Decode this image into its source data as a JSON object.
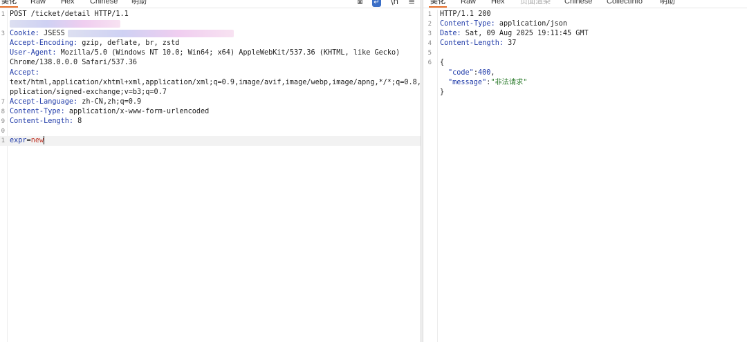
{
  "request": {
    "tabs": [
      "美化",
      "Raw",
      "Hex",
      "Chinese",
      "明助"
    ],
    "lines": [
      {
        "ln": "1",
        "text": "POST /ticket/detail HTTP/1.1"
      },
      {
        "ln": "",
        "redacted": true
      },
      {
        "ln": "3",
        "name": "Cookie:",
        "value": " JSESS"
      },
      {
        "ln": "",
        "name": "Accept-Encoding:",
        "value": " gzip, deflate, br, zstd"
      },
      {
        "ln": "",
        "name": "User-Agent:",
        "value": " Mozilla/5.0 (Windows NT 10.0; Win64; x64) AppleWebKit/537.36 (KHTML, like Gecko)"
      },
      {
        "ln": "",
        "text": "Chrome/138.0.0.0 Safari/537.36"
      },
      {
        "ln": "",
        "name": "Accept:",
        "value": ""
      },
      {
        "ln": "",
        "text": "text/html,application/xhtml+xml,application/xml;q=0.9,image/avif,image/webp,image/apng,*/*;q=0.8,a"
      },
      {
        "ln": "",
        "text": "pplication/signed-exchange;v=b3;q=0.7"
      },
      {
        "ln": "7",
        "name": "Accept-Language:",
        "value": " zh-CN,zh;q=0.9"
      },
      {
        "ln": "8",
        "name": "Content-Type:",
        "value": " application/x-www-form-urlencoded"
      },
      {
        "ln": "9",
        "name": "Content-Length:",
        "value": " 8"
      },
      {
        "ln": "0",
        "text": ""
      },
      {
        "ln": "1",
        "body_key": "expr",
        "body_eq": "=",
        "body_val": "new"
      }
    ]
  },
  "response": {
    "tabs": [
      "美化",
      "Raw",
      "Hex",
      "页面渲染",
      "Chinese",
      "CollectInfo",
      "明助"
    ],
    "lines": [
      {
        "ln": "1",
        "text": "HTTP/1.1 200"
      },
      {
        "ln": "2",
        "name": "Content-Type:",
        "value": " application/json"
      },
      {
        "ln": "3",
        "name": "Date:",
        "value": " Sat, 09 Aug 2025 19:11:45 GMT"
      },
      {
        "ln": "4",
        "name": "Content-Length:",
        "value": " 37"
      },
      {
        "ln": "5",
        "text": ""
      },
      {
        "ln": "6",
        "text": "{"
      },
      {
        "ln": "",
        "json_key": "\"code\"",
        "json_sep": ":",
        "json_num": "400",
        "json_end": ","
      },
      {
        "ln": "",
        "json_key": "\"message\"",
        "json_sep": ":",
        "json_str": "\"非法请求\""
      },
      {
        "ln": "",
        "text": "}"
      }
    ]
  }
}
